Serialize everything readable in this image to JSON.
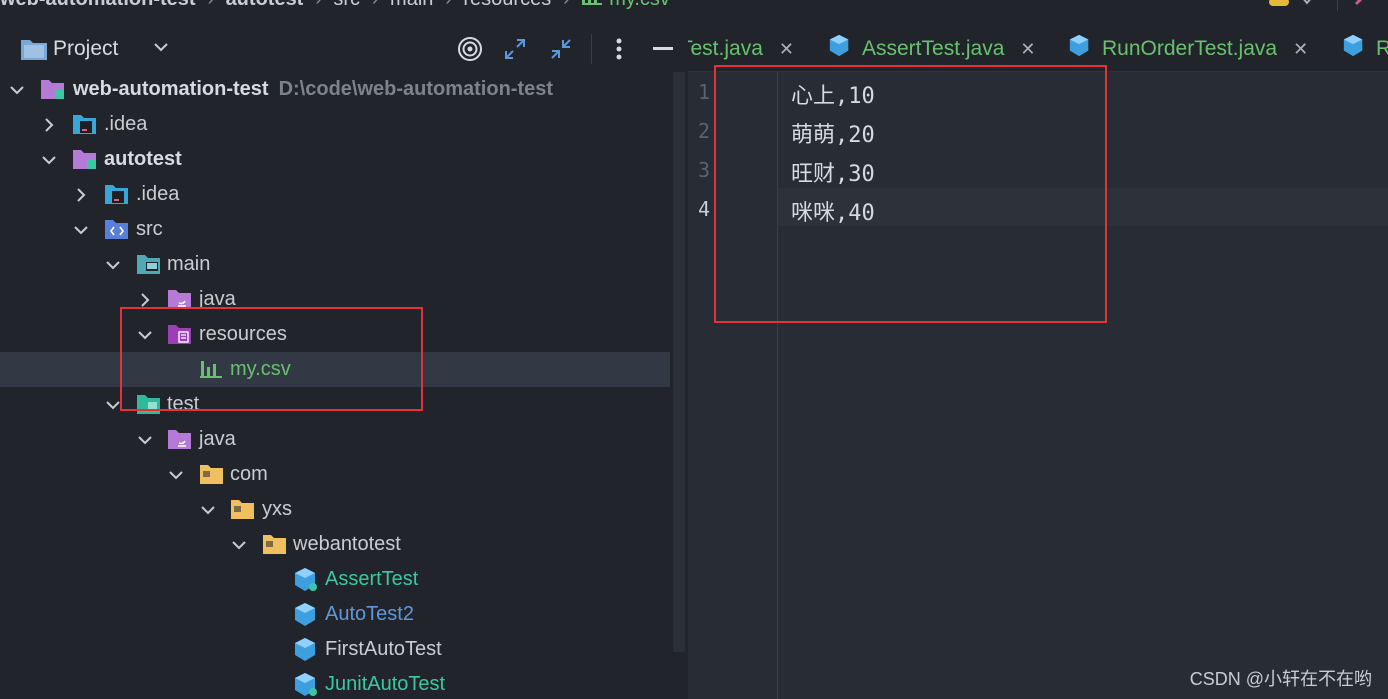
{
  "breadcrumb": {
    "items": [
      "web-automation-test",
      "autotest",
      "src",
      "main",
      "resources",
      "my.csv"
    ]
  },
  "project_panel": {
    "title": "Project",
    "tree": [
      {
        "label": "web-automation-test",
        "hint": "D:\\code\\web-automation-test",
        "icon": "module-folder-icon"
      },
      {
        "label": ".idea",
        "icon": "idea-folder-icon"
      },
      {
        "label": "autotest",
        "icon": "module-folder-icon"
      },
      {
        "label": ".idea",
        "icon": "idea-folder-icon"
      },
      {
        "label": "src",
        "icon": "source-folder-icon"
      },
      {
        "label": "main",
        "icon": "main-folder-icon"
      },
      {
        "label": "java",
        "icon": "java-folder-icon"
      },
      {
        "label": "resources",
        "icon": "resources-folder-icon"
      },
      {
        "label": "my.csv",
        "icon": "csv-file-icon"
      },
      {
        "label": "test",
        "icon": "test-folder-icon"
      },
      {
        "label": "java",
        "icon": "java-folder-icon"
      },
      {
        "label": "com",
        "icon": "package-folder-icon"
      },
      {
        "label": "yxs",
        "icon": "package-folder-icon"
      },
      {
        "label": "webantotest",
        "icon": "package-folder-icon"
      },
      {
        "label": "AssertTest",
        "icon": "java-class-icon"
      },
      {
        "label": "AutoTest2",
        "icon": "java-class-icon"
      },
      {
        "label": "FirstAutoTest",
        "icon": "java-class-icon"
      },
      {
        "label": "JunitAutoTest",
        "icon": "java-class-icon"
      }
    ]
  },
  "editor": {
    "tabs": [
      {
        "label": "Test.java"
      },
      {
        "label": "AssertTest.java"
      },
      {
        "label": "RunOrderTest.java"
      },
      {
        "label": "R"
      }
    ],
    "line_numbers": [
      "1",
      "2",
      "3",
      "4"
    ],
    "lines": [
      "心上,10",
      "萌萌,20",
      "旺财,30",
      "咪咪,40"
    ]
  },
  "watermark": "CSDN @小轩在不在哟",
  "colors": {
    "background": "#21252b",
    "editor_background": "#282c34",
    "annotation_red": "#e0343a",
    "file_green": "#69c16f"
  }
}
